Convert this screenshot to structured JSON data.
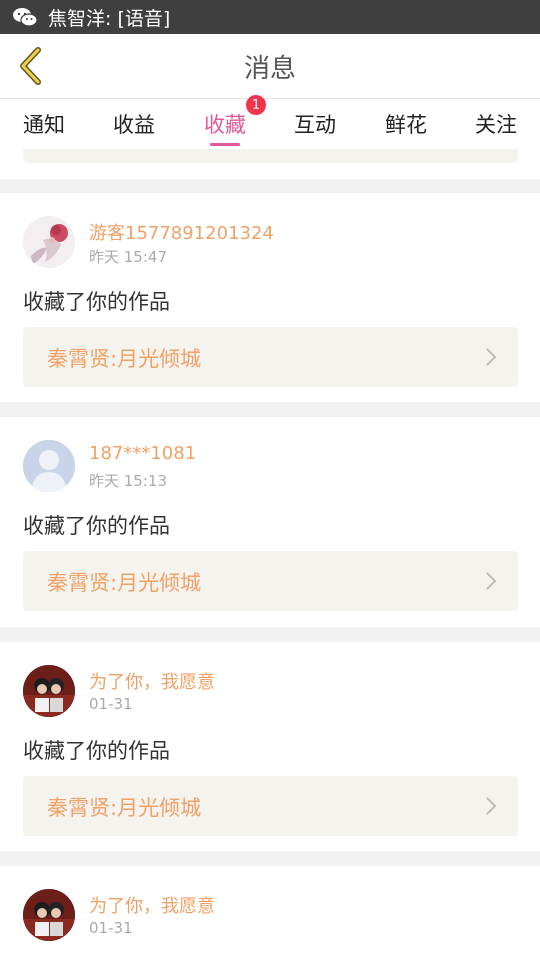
{
  "status_bar": {
    "icon": "wechat-icon",
    "notification_text": "焦智洋: [语音]"
  },
  "header": {
    "back_icon": "chevron-left-icon",
    "title": "消息"
  },
  "tabs": [
    {
      "label": "通知"
    },
    {
      "label": "收益"
    },
    {
      "label": "收藏",
      "active": true,
      "badge": "1"
    },
    {
      "label": "互动"
    },
    {
      "label": "鲜花"
    },
    {
      "label": "关注"
    }
  ],
  "messages": [
    {
      "avatar": "illustrated-girl-avatar",
      "username": "游客1577891201324",
      "time": "昨天 15:47",
      "action": "收藏了你的作品",
      "work_title": "秦霄贤:月光倾城"
    },
    {
      "avatar": "default-user-avatar",
      "username": "187***1081",
      "time": "昨天 15:13",
      "action": "收藏了你的作品",
      "work_title": "秦霄贤:月光倾城"
    },
    {
      "avatar": "photo-couple-avatar",
      "username": "为了你，我愿意",
      "time": "01-31",
      "action": "收藏了你的作品",
      "work_title": "秦霄贤:月光倾城"
    },
    {
      "avatar": "photo-couple-avatar",
      "username": "为了你，我愿意",
      "time": "01-31"
    }
  ],
  "colors": {
    "accent_pink": "#e05a9a",
    "username_orange": "#f0a167",
    "badge_red": "#f3344c",
    "status_bar": "#3f3f3f"
  }
}
